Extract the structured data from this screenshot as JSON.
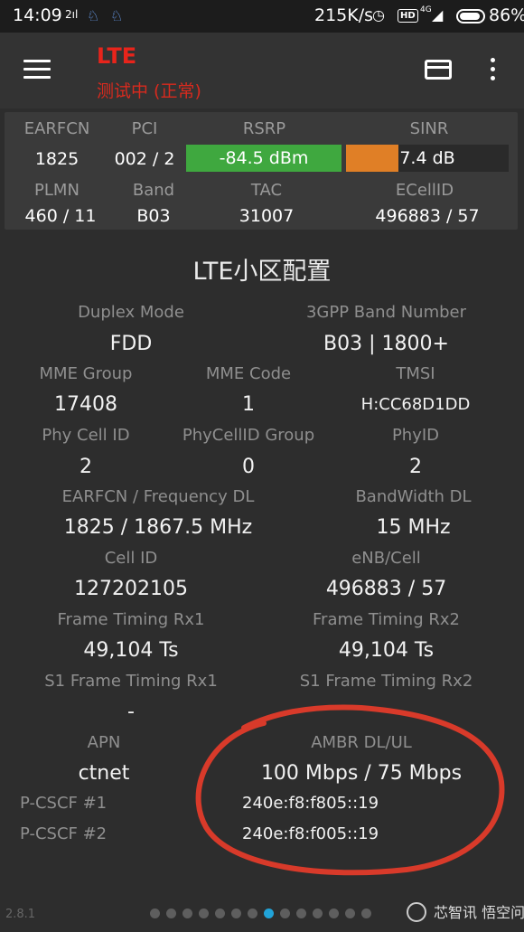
{
  "status_bar": {
    "time": "14:09",
    "signal_text": "2ıl",
    "speed": "215K/s",
    "hd_badge": "HD",
    "network": "4G",
    "battery_pct": "86%"
  },
  "app_bar": {
    "title": "LTE",
    "subtitle": "测试中 (正常)"
  },
  "summary": {
    "earfcn": {
      "label": "EARFCN",
      "value": "1825"
    },
    "pci": {
      "label": "PCI",
      "value": "002 / 2"
    },
    "rsrp": {
      "label": "RSRP",
      "value": "-84.5 dBm",
      "level": 1.0,
      "color": "#3fa83f"
    },
    "sinr": {
      "label": "SINR",
      "value": "7.4 dB",
      "level": 0.32,
      "color": "#e07f26"
    },
    "plmn": {
      "label": "PLMN",
      "value": "460 / 11"
    },
    "band": {
      "label": "Band",
      "value": "B03"
    },
    "tac": {
      "label": "TAC",
      "value": "31007"
    },
    "ecellid": {
      "label": "ECellID",
      "value": "496883 / 57"
    }
  },
  "config": {
    "title": "LTE小区配置",
    "duplex_mode": {
      "label": "Duplex Mode",
      "value": "FDD"
    },
    "band_number": {
      "label": "3GPP Band Number",
      "value": "B03 | 1800+"
    },
    "mme_group": {
      "label": "MME Group",
      "value": "17408"
    },
    "mme_code": {
      "label": "MME Code",
      "value": "1"
    },
    "tmsi": {
      "label": "TMSI",
      "value": "H:CC68D1DD"
    },
    "phy_cell_id": {
      "label": "Phy Cell ID",
      "value": "2"
    },
    "phy_cell_id_group": {
      "label": "PhyCellID Group",
      "value": "0"
    },
    "phy_id": {
      "label": "PhyID",
      "value": "2"
    },
    "earfcn_dl": {
      "label": "EARFCN / Frequency DL",
      "value": "1825 / 1867.5 MHz"
    },
    "bandwidth_dl": {
      "label": "BandWidth DL",
      "value": "15 MHz"
    },
    "cell_id": {
      "label": "Cell ID",
      "value": "127202105"
    },
    "enb_cell": {
      "label": "eNB/Cell",
      "value": "496883 / 57"
    },
    "frame_timing_rx1": {
      "label": "Frame Timing Rx1",
      "value": "49,104 Ts"
    },
    "frame_timing_rx2": {
      "label": "Frame Timing Rx2",
      "value": "49,104 Ts"
    },
    "s1_frame_timing_rx1": {
      "label": "S1 Frame Timing Rx1",
      "value": "-"
    },
    "s1_frame_timing_rx2": {
      "label": "S1 Frame Timing Rx2",
      "value": ""
    },
    "apn": {
      "label": "APN",
      "value": "ctnet"
    },
    "ambr": {
      "label": "AMBR DL/UL",
      "value": "100 Mbps / 75 Mbps"
    },
    "pcscf1": {
      "label": "P-CSCF #1",
      "value": "240e:f8:f805::19"
    },
    "pcscf2": {
      "label": "P-CSCF #2",
      "value": "240e:f8:f005::19"
    }
  },
  "footer": {
    "version": "2.8.1",
    "page_count": 14,
    "active_page": 8,
    "watermark": "芯智讯 悟空问答"
  },
  "colors": {
    "background": "#2d2d2d",
    "title_red": "#e8241b",
    "annotation_red": "#d83a2a",
    "active_dot": "#21a3d8"
  }
}
